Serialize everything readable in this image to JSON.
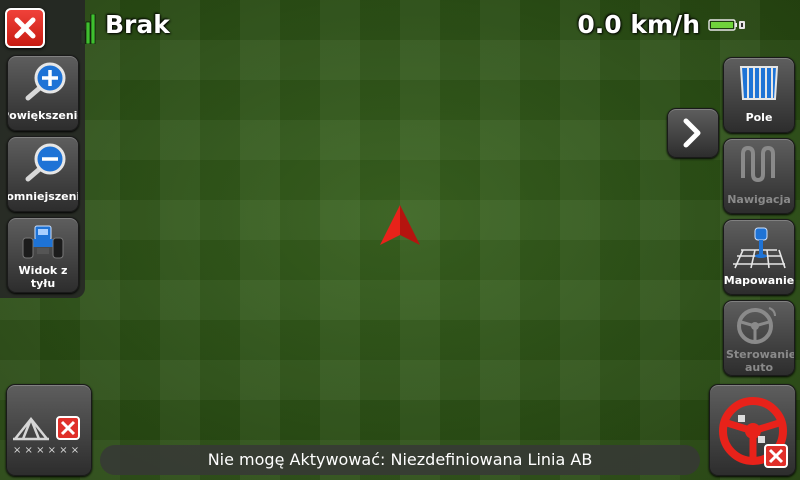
{
  "header": {
    "gps_status": "Brak",
    "speed": "0.0 km/h"
  },
  "left_toolbar": {
    "zoom_in_label": "Powiększenie",
    "zoom_out_label": "Pomniejszenie",
    "rear_view_label": "Widok z tyłu"
  },
  "right_toolbar": {
    "field_label": "Pole",
    "navigation_label": "Nawigacja",
    "mapping_label": "Mapowanie",
    "autosteer_label": "Sterowanie auto"
  },
  "status_message": "Nie mogę Aktywować: Niezdefiniowana Linia AB",
  "colors": {
    "field_green": "#2f5518",
    "marker_red": "#e8221a",
    "close_red": "#e0302a",
    "zoom_blue": "#1e73d6",
    "battery_green": "#6fd33b"
  },
  "icons": {
    "close": "close-icon",
    "zoom_in": "magnifier-plus-icon",
    "zoom_out": "magnifier-minus-icon",
    "rear_view": "tractor-icon",
    "field": "field-rows-icon",
    "navigation": "zigzag-path-icon",
    "mapping": "map-pin-grid-icon",
    "autosteer": "steering-wheel-icon",
    "boom": "sprayer-boom-icon",
    "next": "chevron-right-icon"
  }
}
